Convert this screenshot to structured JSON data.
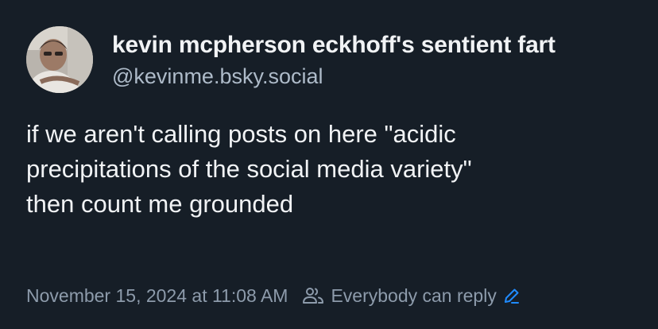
{
  "author": {
    "display_name": "kevin mcpherson eckhoff's sentient fart",
    "handle": "@kevinme.bsky.social"
  },
  "post": {
    "text_lines": [
      "if we aren't calling posts on here \"acidic",
      "precipitations of the social media variety\"",
      "then count me grounded"
    ]
  },
  "meta": {
    "timestamp": "November 15, 2024 at 11:08 AM",
    "reply_setting_label": "Everybody can reply"
  },
  "icons": {
    "reply_setting": "people-icon",
    "edit": "pencil-icon"
  },
  "colors": {
    "background": "#161e27",
    "text": "#f1f3f5",
    "muted": "#8d9bab",
    "handle": "#aebbc9",
    "accent": "#208bfe"
  }
}
